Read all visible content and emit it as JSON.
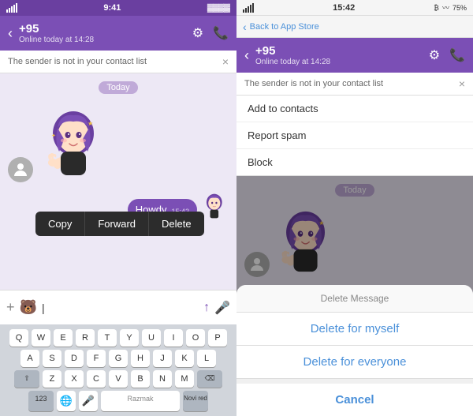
{
  "left": {
    "status_bar": {
      "signal": "●●●●●",
      "wifi": "WiFi",
      "time": "9:41",
      "battery": "🔋"
    },
    "header": {
      "back": "‹",
      "phone": "+95",
      "status": "Online today at 14:28",
      "gear_icon": "⚙",
      "call_icon": "📞"
    },
    "notice": "The sender is not in your contact list",
    "notice_close": "×",
    "date_label": "Today",
    "context_menu": {
      "copy": "Copy",
      "forward": "Forward",
      "delete": "Delete"
    },
    "message": {
      "text": "Howdy",
      "time": "15:42"
    },
    "input": {
      "plus": "+",
      "emoji": "🐻",
      "placeholder": "|",
      "send": "↑",
      "mic": "🎤"
    },
    "keyboard": {
      "row1": [
        "Q",
        "W",
        "E",
        "R",
        "T",
        "Y",
        "U",
        "I",
        "O",
        "P"
      ],
      "row2": [
        "A",
        "S",
        "D",
        "F",
        "G",
        "H",
        "J",
        "K",
        "L"
      ],
      "row3": [
        "⇧",
        "Z",
        "X",
        "C",
        "V",
        "B",
        "N",
        "M",
        "⌫"
      ],
      "row4_special1": "123",
      "row4_globe": "🌐",
      "row4_mic": "🎤",
      "row4_space": "Razmak",
      "row4_done": "Novi red"
    }
  },
  "right": {
    "top_nav": {
      "back": "‹",
      "label": "Back to App Store"
    },
    "status_bar": {
      "time": "15:42",
      "battery_pct": "75%"
    },
    "header": {
      "back": "‹",
      "phone": "+95",
      "status": "Online today at 14:28",
      "gear_icon": "⚙",
      "call_icon": "📞"
    },
    "notice": "The sender is not in your contact list",
    "notice_close": "×",
    "dropdown": {
      "item1": "Add to contacts",
      "item2": "Report spam",
      "item3": "Block"
    },
    "date_label": "Today",
    "modal": {
      "title": "Delete Message",
      "action1": "Delete for myself",
      "action2": "Delete for everyone",
      "cancel": "Cancel"
    }
  }
}
